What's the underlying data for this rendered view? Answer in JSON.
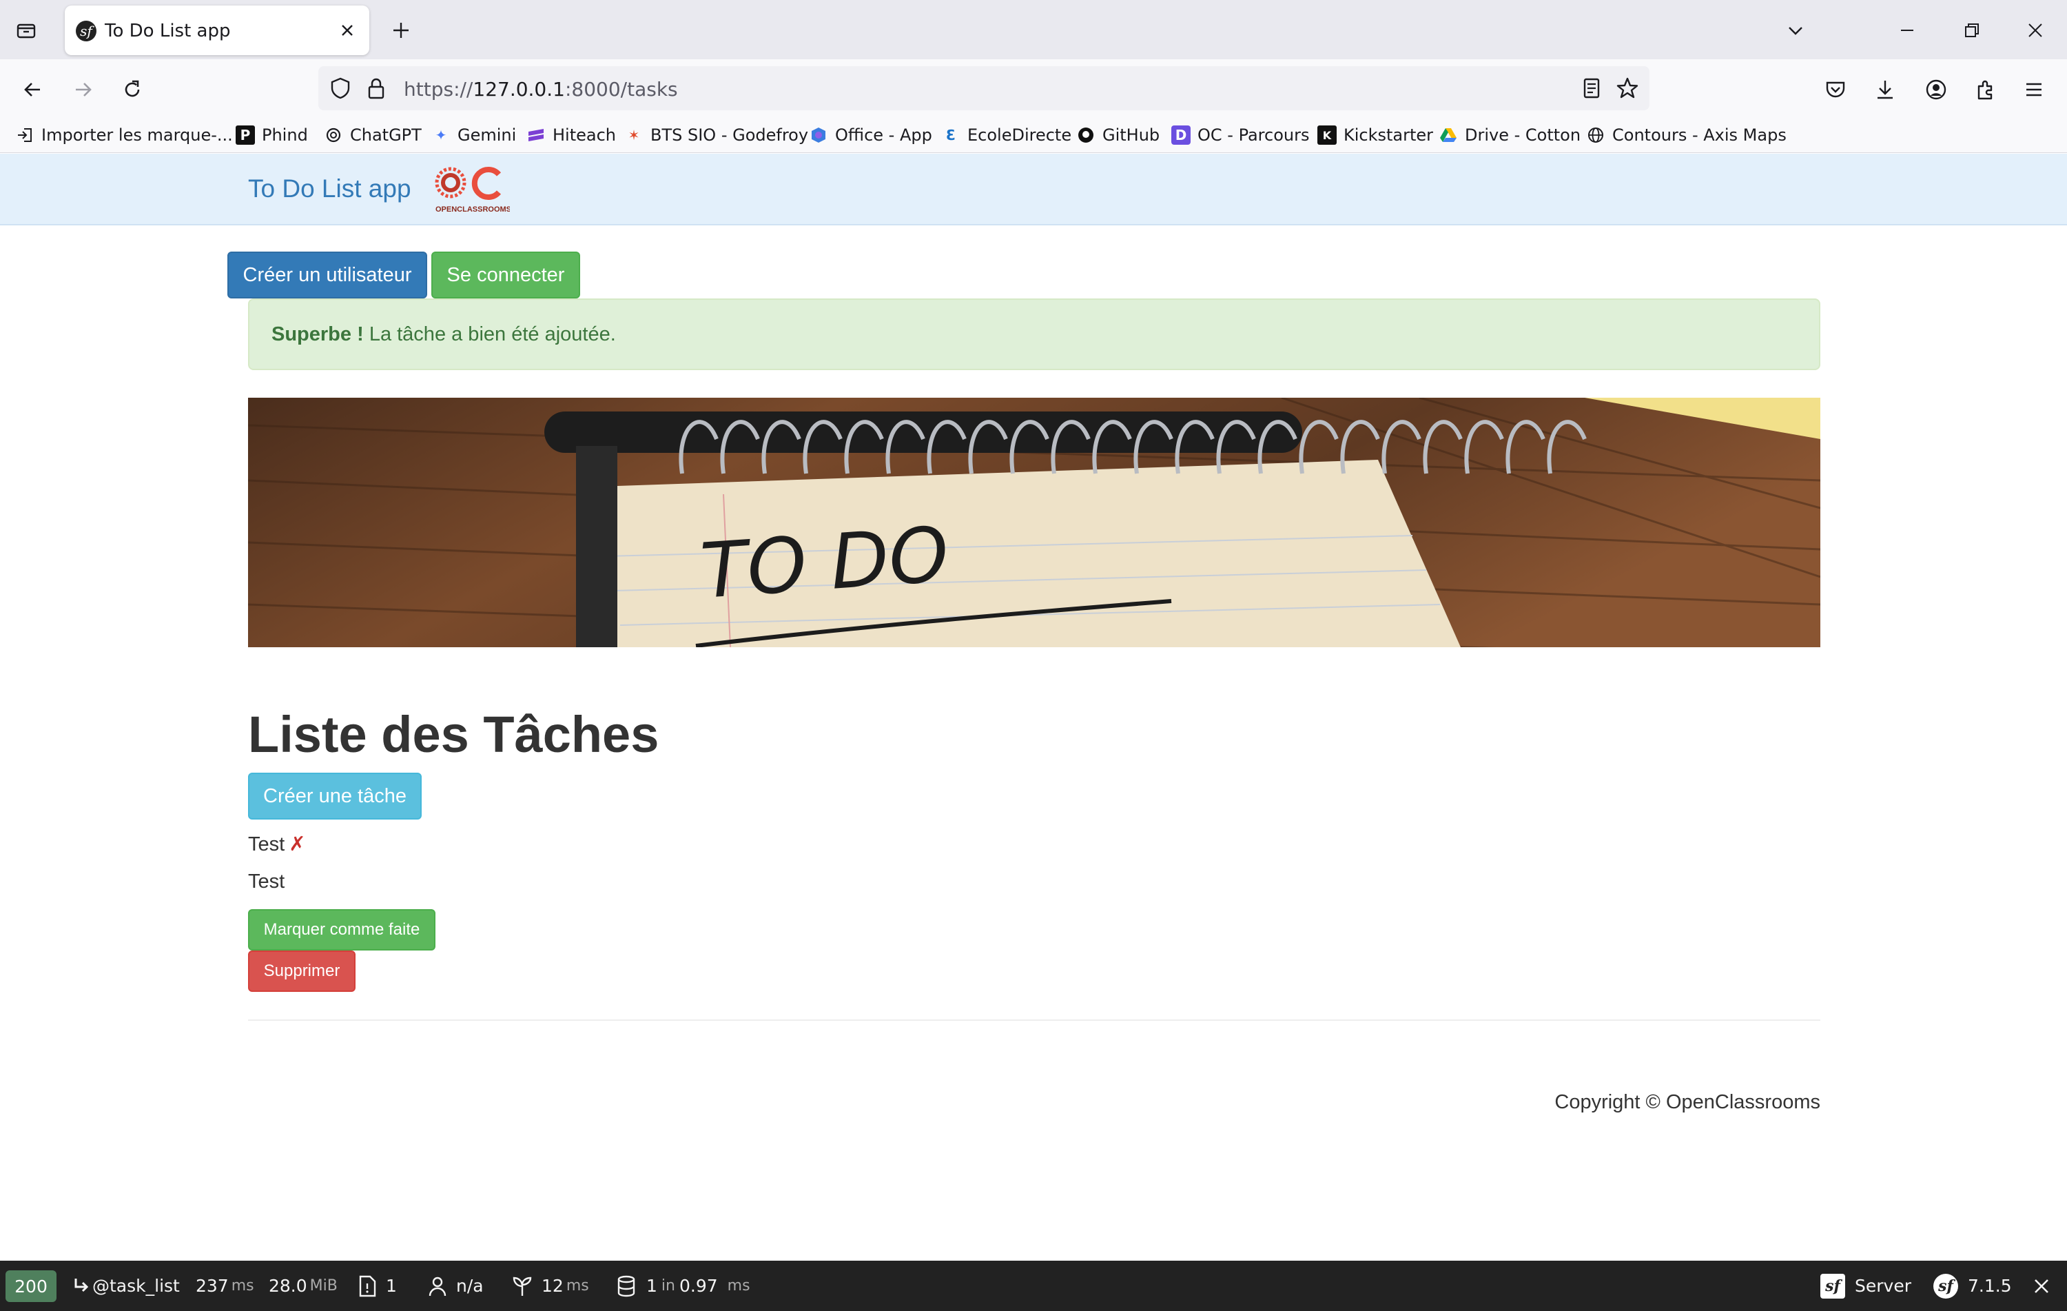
{
  "browser": {
    "tab_title": "To Do List app",
    "url_prefix": "https://",
    "url_host": "127.0.0.1",
    "url_rest": ":8000/tasks"
  },
  "bookmarks": [
    {
      "label": "Importer les marque-...",
      "icon": "import-icon"
    },
    {
      "label": "Phind",
      "icon": "phind-icon"
    },
    {
      "label": "ChatGPT",
      "icon": "chatgpt-icon"
    },
    {
      "label": "Gemini",
      "icon": "gemini-icon"
    },
    {
      "label": "Hiteach",
      "icon": "hiteach-icon"
    },
    {
      "label": "BTS SIO - Godefroy",
      "icon": "bts-icon"
    },
    {
      "label": "Office - App",
      "icon": "office-icon"
    },
    {
      "label": "EcoleDirecte",
      "icon": "ecoledirecte-icon"
    },
    {
      "label": "GitHub",
      "icon": "github-icon"
    },
    {
      "label": "OC - Parcours",
      "icon": "oc-icon"
    },
    {
      "label": "Kickstarter",
      "icon": "kickstarter-icon"
    },
    {
      "label": "Drive - Cotton",
      "icon": "drive-icon"
    },
    {
      "label": "Contours - Axis Maps",
      "icon": "globe-icon"
    }
  ],
  "app": {
    "brand": "To Do List app",
    "logo_text": "OPENCLASSROOMS",
    "create_user_label": "Créer un utilisateur",
    "login_label": "Se connecter",
    "alert_strong": "Superbe !",
    "alert_text": "La tâche a bien été ajoutée.",
    "hero_text": "TO DO",
    "page_title": "Liste des Tâches",
    "create_task_label": "Créer une tâche",
    "task": {
      "title": "Test",
      "status_mark": "✗",
      "content": "Test",
      "mark_done_label": "Marquer comme faite",
      "delete_label": "Supprimer"
    },
    "footer": "Copyright © OpenClassrooms"
  },
  "profiler": {
    "status": "200",
    "route": "@task_list",
    "time_value": "237",
    "time_unit": "ms",
    "memory_value": "28.0",
    "memory_unit": "MiB",
    "requests": "1",
    "user": "n/a",
    "twig_value": "12",
    "twig_unit": "ms",
    "db_count": "1",
    "db_in": "in",
    "db_time": "0.97",
    "db_unit": "ms",
    "server_label": "Server",
    "version": "7.1.5"
  },
  "colors": {
    "primary": "#337ab7",
    "success": "#5cb85c",
    "info": "#5bc0de",
    "danger": "#d9534f",
    "navbar_bg": "#e3f0fb",
    "alert_bg": "#dff0d8",
    "profiler_status": "#4f805d"
  }
}
